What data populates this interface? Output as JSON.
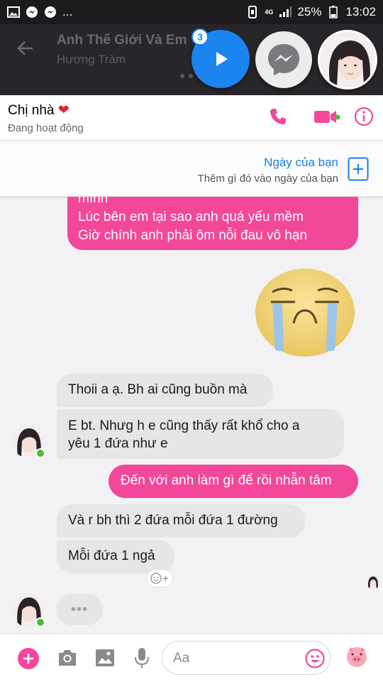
{
  "status_bar": {
    "ellipsis": "...",
    "network": "4G",
    "battery": "25%",
    "time": "13:02"
  },
  "media_bar": {
    "song_title": "Anh Thế Giới Và Em",
    "artist": "Hương Tràm",
    "chat_head_badge": "3"
  },
  "header": {
    "name": "Chị nhà",
    "status": "Đang hoạt động"
  },
  "day_banner": {
    "title": "Ngày của bạn",
    "subtitle": "Thêm gì đó vào ngày của bạn"
  },
  "messages": [
    {
      "direction": "out",
      "text": "mình"
    },
    {
      "direction": "out",
      "text": "Lúc bên em tại sao anh quá yếu mềm"
    },
    {
      "direction": "out",
      "text": "Giờ chính anh phải ôm nỗi đau vô hạn"
    },
    {
      "direction": "in",
      "text": "Thoii a ạ. Bh ai cũng buồn mà"
    },
    {
      "direction": "in",
      "text": "E bt. Nhưg h e cũng thấy rất khổ cho a"
    },
    {
      "direction": "in",
      "text": "yêu 1 đứa như e"
    },
    {
      "direction": "out",
      "text": "Đến với anh làm gì để rồi nhẫn tâm"
    },
    {
      "direction": "in",
      "text": "Và r bh thì 2 đứa mỗi đứa 1 đường"
    },
    {
      "direction": "in",
      "text": "Mỗi đứa 1 ngả"
    }
  ],
  "typing_dots": "•••",
  "reaction_add": "+",
  "composer": {
    "placeholder": "Aa"
  },
  "colors": {
    "accent": "#f3479a",
    "link": "#1a7ee8",
    "online": "#4bbd3a"
  }
}
